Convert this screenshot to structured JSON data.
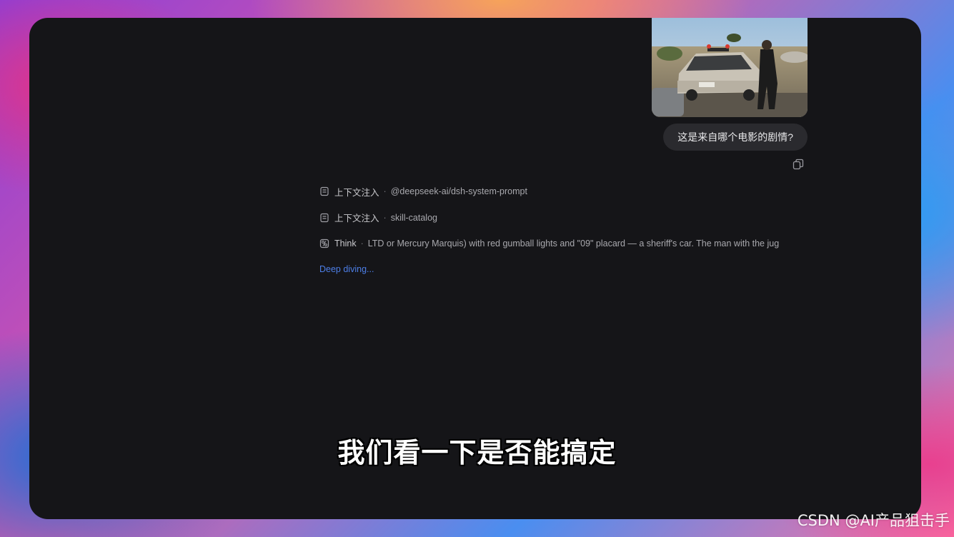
{
  "conversation": {
    "user_message": "这是来自哪个电影的剧情?",
    "image_name": "photo-attachment"
  },
  "steps": [
    {
      "icon": "document-icon",
      "label": "上下文注入",
      "separator": "·",
      "value": "@deepseek-ai/dsh-system-prompt"
    },
    {
      "icon": "document-icon",
      "label": "上下文注入",
      "separator": "·",
      "value": "skill-catalog"
    },
    {
      "icon": "think-icon",
      "label": "Think",
      "separator": "·",
      "value": "LTD or Mercury Marquis) with red gumball lights and \"09\" placard — a sheriff's car. The man with the jug"
    }
  ],
  "status_text": "Deep diving...",
  "video_subtitle": "我们看一下是否能搞定",
  "watermark": "CSDN @AI产品狙击手",
  "colors": {
    "window_bg": "#151518",
    "bubble_bg": "#2a2a2e",
    "status_accent": "#4d7fe8"
  }
}
